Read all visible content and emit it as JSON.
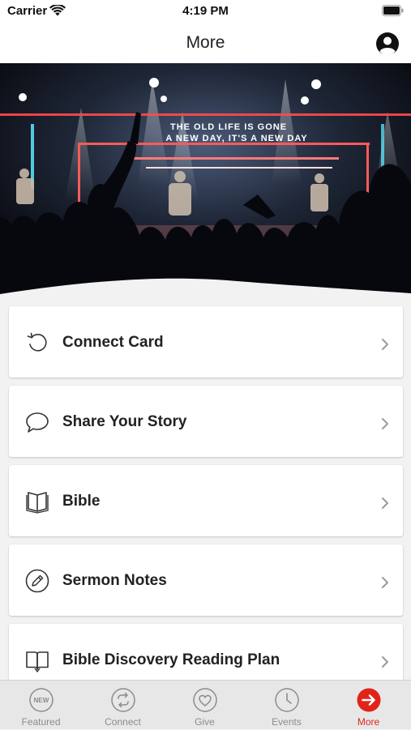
{
  "status": {
    "carrier": "Carrier",
    "time": "4:19 PM"
  },
  "header": {
    "title": "More"
  },
  "hero": {
    "banner_text_line1": "THE OLD LIFE IS GONE",
    "banner_text_line2": "A NEW DAY, IT'S A NEW DAY"
  },
  "menu": {
    "items": [
      {
        "label": "Connect Card",
        "icon": "refresh-arrow-icon"
      },
      {
        "label": "Share Your Story",
        "icon": "speech-bubble-icon"
      },
      {
        "label": "Bible",
        "icon": "open-book-icon"
      },
      {
        "label": "Sermon Notes",
        "icon": "pencil-circle-icon"
      },
      {
        "label": "Bible Discovery Reading Plan",
        "icon": "book-icon"
      }
    ]
  },
  "tabs": [
    {
      "label": "Featured",
      "icon": "new-badge-icon",
      "active": false
    },
    {
      "label": "Connect",
      "icon": "connect-arrows-icon",
      "active": false
    },
    {
      "label": "Give",
      "icon": "heart-icon",
      "active": false
    },
    {
      "label": "Events",
      "icon": "clock-icon",
      "active": false
    },
    {
      "label": "More",
      "icon": "arrow-right-circle-icon",
      "active": true
    }
  ],
  "colors": {
    "accent": "#e2231a",
    "tab_inactive": "#8c8c8c",
    "background": "#f2f2f2"
  }
}
